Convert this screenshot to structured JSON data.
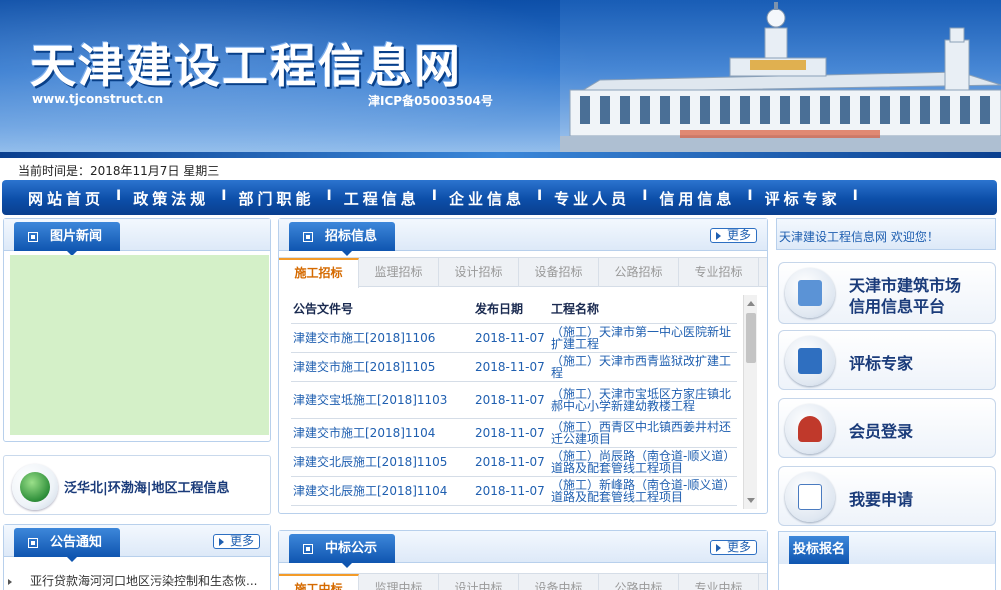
{
  "header": {
    "title": "天津建设工程信息网",
    "url": "www.tjconstruct.cn",
    "icp": "津ICP备05003504号"
  },
  "datebar": {
    "text": "当前时间是：2018年11月7日 星期三"
  },
  "nav": {
    "items": [
      "网站首页",
      "政策法规",
      "部门职能",
      "工程信息",
      "企业信息",
      "专业人员",
      "信用信息",
      "评标专家"
    ],
    "separator": "I"
  },
  "picture_news": {
    "title": "图片新闻"
  },
  "region": {
    "label": "泛华北|环渤海|地区工程信息"
  },
  "notice": {
    "title": "公告通知",
    "more": "更多",
    "items": [
      "亚行贷款海河河口地区污染控制和生态恢..."
    ]
  },
  "tender": {
    "title": "招标信息",
    "more": "更多",
    "tabs": [
      "施工招标",
      "监理招标",
      "设计招标",
      "设备招标",
      "公路招标",
      "专业招标"
    ],
    "columns": [
      "公告文件号",
      "发布日期",
      "工程名称"
    ],
    "rows": [
      {
        "doc": "津建交市施工[2018]1106",
        "date": "2018-11-07",
        "name": "（施工）天津市第一中心医院新址扩建工程"
      },
      {
        "doc": "津建交市施工[2018]1105",
        "date": "2018-11-07",
        "name": "（施工）天津市西青监狱改扩建工程"
      },
      {
        "doc": "津建交宝坻施工[2018]1103",
        "date": "2018-11-07",
        "name": "（施工）天津市宝坻区方家庄镇北郝中心小学新建幼教楼工程"
      },
      {
        "doc": "津建交市施工[2018]1104",
        "date": "2018-11-07",
        "name": "（施工）西青区中北镇西姜井村还迁公建项目"
      },
      {
        "doc": "津建交北辰施工[2018]1105",
        "date": "2018-11-07",
        "name": "（施工）尚辰路（南仓道-顺义道）道路及配套管线工程项目"
      },
      {
        "doc": "津建交北辰施工[2018]1104",
        "date": "2018-11-07",
        "name": "（施工）新峰路（南仓道-顺义道）道路及配套管线工程项目"
      }
    ]
  },
  "award": {
    "title": "中标公示",
    "more": "更多",
    "tabs": [
      "施工中标",
      "监理中标",
      "设计中标",
      "设备中标",
      "公路中标",
      "专业中标"
    ]
  },
  "sidebar": {
    "welcome": "天津建设工程信息网 欢迎您！",
    "buttons": [
      {
        "line1": "天津市建筑市场",
        "line2": "信用信息平台",
        "icon": "credit-platform-icon",
        "color": "#5b93d6"
      },
      {
        "line1": "评标专家",
        "line2": "",
        "icon": "expert-book-icon",
        "color": "#2f6fc0"
      },
      {
        "line1": "会员登录",
        "line2": "",
        "icon": "members-icon",
        "color": "#c0392b"
      },
      {
        "line1": "我要申请",
        "line2": "",
        "icon": "pen-apply-icon",
        "color": "#4a7bc0"
      }
    ],
    "bid_title": "投标报名"
  }
}
